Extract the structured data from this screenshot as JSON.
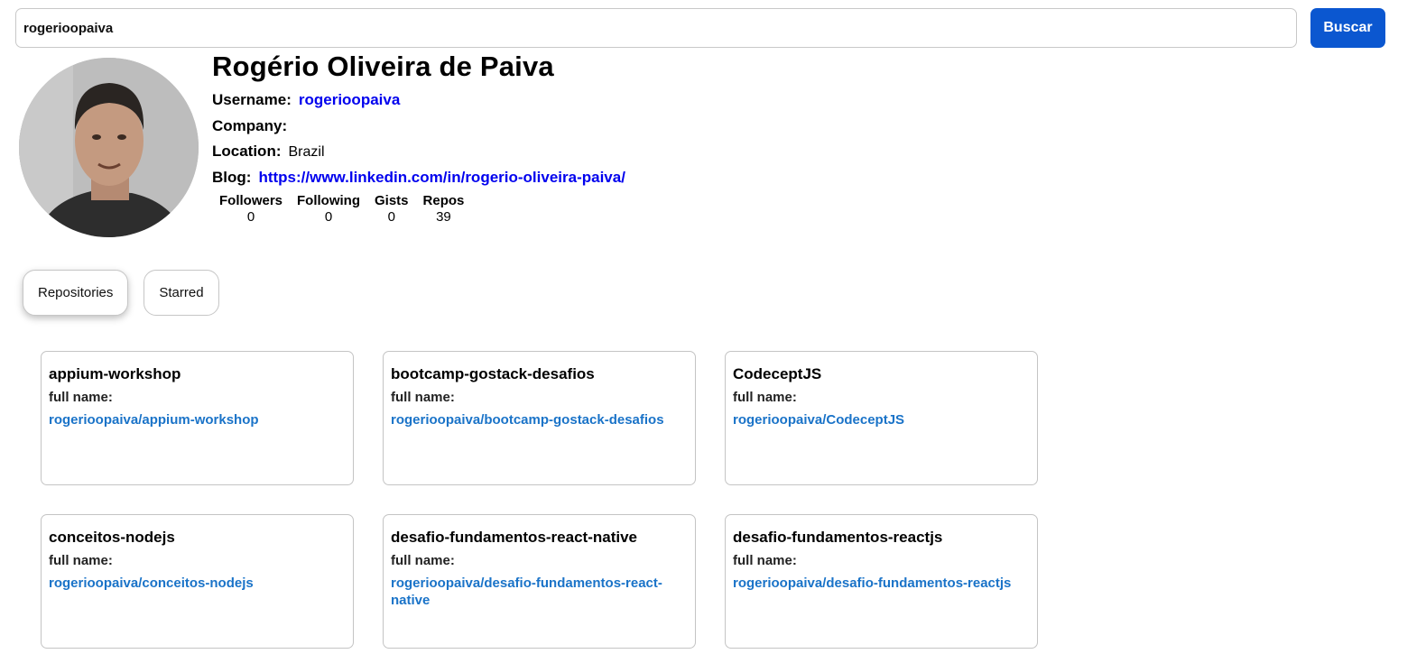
{
  "search": {
    "value": "rogerioopaiva",
    "button_label": "Buscar"
  },
  "profile": {
    "name": "Rogério Oliveira de Paiva",
    "username_label": "Username:",
    "username": "rogerioopaiva",
    "company_label": "Company:",
    "company": "",
    "location_label": "Location:",
    "location": "Brazil",
    "blog_label": "Blog:",
    "blog": "https://www.linkedin.com/in/rogerio-oliveira-paiva/"
  },
  "stats": [
    {
      "label": "Followers",
      "value": "0"
    },
    {
      "label": "Following",
      "value": "0"
    },
    {
      "label": "Gists",
      "value": "0"
    },
    {
      "label": "Repos",
      "value": "39"
    }
  ],
  "tabs": [
    {
      "label": "Repositories",
      "active": true
    },
    {
      "label": "Starred",
      "active": false
    }
  ],
  "repos": [
    {
      "name": "appium-workshop",
      "full_name_label": "full name:",
      "full_name": "rogerioopaiva/appium-workshop"
    },
    {
      "name": "bootcamp-gostack-desafios",
      "full_name_label": "full name:",
      "full_name": "rogerioopaiva/bootcamp-gostack-desafios"
    },
    {
      "name": "CodeceptJS",
      "full_name_label": "full name:",
      "full_name": "rogerioopaiva/CodeceptJS"
    },
    {
      "name": "conceitos-nodejs",
      "full_name_label": "full name:",
      "full_name": "rogerioopaiva/conceitos-nodejs"
    },
    {
      "name": "desafio-fundamentos-react-native",
      "full_name_label": "full name:",
      "full_name": "rogerioopaiva/desafio-fundamentos-react-native"
    },
    {
      "name": "desafio-fundamentos-reactjs",
      "full_name_label": "full name:",
      "full_name": "rogerioopaiva/desafio-fundamentos-reactjs"
    }
  ],
  "colors": {
    "primary_button": "#0b57d0",
    "link": "#0000ee",
    "repo_link": "#1a73c8"
  }
}
